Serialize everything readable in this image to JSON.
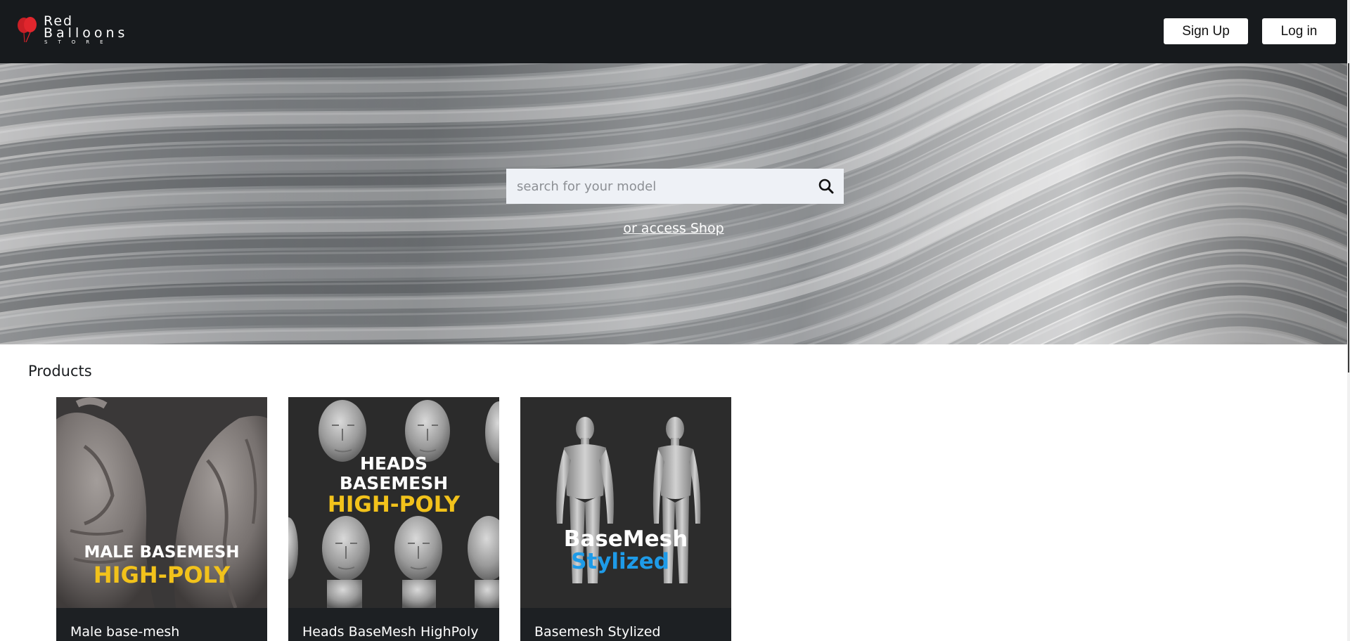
{
  "header": {
    "logo": {
      "line1": "Red",
      "line2": "Balloons",
      "line3": "STORE",
      "balloon_color": "#e0262d"
    },
    "signup_label": "Sign Up",
    "login_label": "Log in"
  },
  "hero": {
    "search": {
      "placeholder": "search for your model",
      "value": ""
    },
    "shop_link": "or access Shop"
  },
  "products": {
    "title": "Products",
    "items": [
      {
        "name": "Male base-mesh",
        "overlay_line1": "MALE BASEMESH",
        "overlay_line2": "HIGH-POLY"
      },
      {
        "name": "Heads BaseMesh HighPoly",
        "overlay_line1": "HEADS",
        "overlay_line2": "BASEMESH",
        "overlay_line3": "HIGH-POLY"
      },
      {
        "name": "Basemesh Stylized",
        "overlay_line1": "BaseMesh",
        "overlay_line2": "Stylized"
      }
    ]
  },
  "colors": {
    "header_bg": "#171a1d",
    "accent_yellow": "#f2c21b",
    "accent_blue": "#1e9be8",
    "card_footer": "#1d2023"
  }
}
